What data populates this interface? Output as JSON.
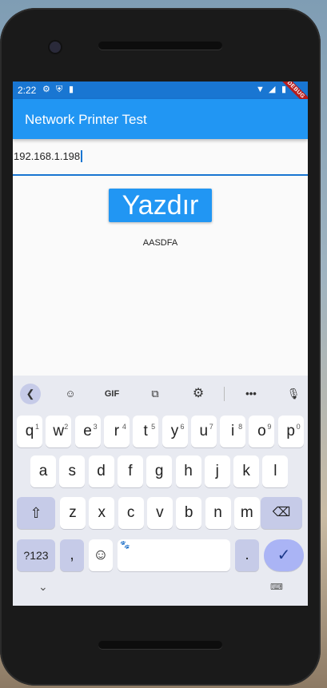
{
  "status": {
    "time": "2:22",
    "debug_banner": "DEBUG"
  },
  "app": {
    "title": "Network Printer Test"
  },
  "ip_field": {
    "value": "192.168.1.198"
  },
  "print_button": {
    "label": "Yazdır"
  },
  "output_text": "AASDFA",
  "keyboard": {
    "toolbar": {
      "gif": "GIF"
    },
    "row1": [
      {
        "k": "q",
        "n": "1"
      },
      {
        "k": "w",
        "n": "2"
      },
      {
        "k": "e",
        "n": "3"
      },
      {
        "k": "r",
        "n": "4"
      },
      {
        "k": "t",
        "n": "5"
      },
      {
        "k": "y",
        "n": "6"
      },
      {
        "k": "u",
        "n": "7"
      },
      {
        "k": "i",
        "n": "8"
      },
      {
        "k": "o",
        "n": "9"
      },
      {
        "k": "p",
        "n": "0"
      }
    ],
    "row2": [
      "a",
      "s",
      "d",
      "f",
      "g",
      "h",
      "j",
      "k",
      "l"
    ],
    "row3": [
      "z",
      "x",
      "c",
      "v",
      "b",
      "n",
      "m"
    ],
    "sym_label": "?123",
    "comma": ",",
    "period": "."
  }
}
